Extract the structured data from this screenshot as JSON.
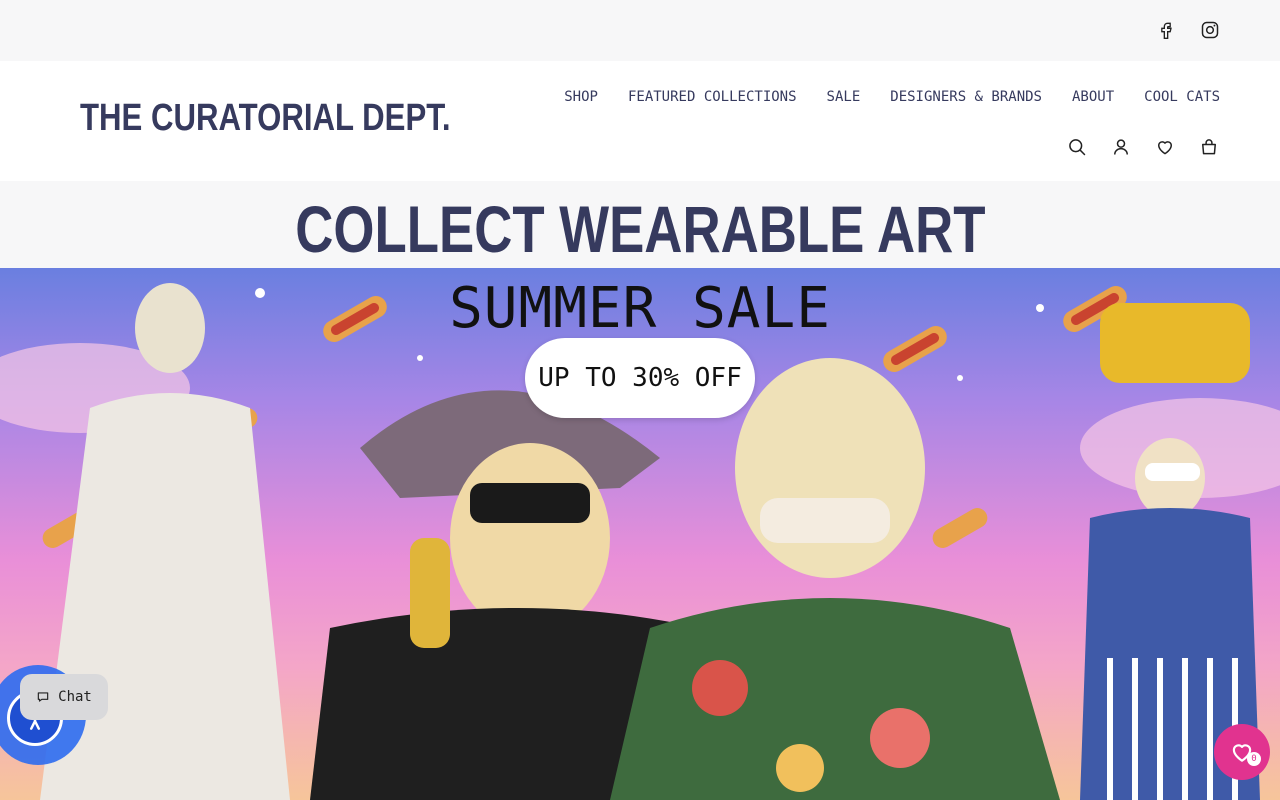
{
  "topbar": {
    "social": [
      {
        "name": "facebook-icon"
      },
      {
        "name": "instagram-icon"
      }
    ]
  },
  "header": {
    "logo": "THE CURATORIAL DEPT.",
    "nav": [
      "SHOP",
      "FEATURED COLLECTIONS",
      "SALE",
      "DESIGNERS & BRANDS",
      "ABOUT",
      "COOL CATS"
    ],
    "icons": [
      "search-icon",
      "account-icon",
      "wishlist-icon",
      "cart-icon"
    ]
  },
  "tagline": "COLLECT WEARABLE ART",
  "hero": {
    "title": "SUMMER SALE",
    "pill": "UP TO 30% OFF"
  },
  "widgets": {
    "chat_label": "Chat",
    "wishlist_count": "0"
  },
  "colors": {
    "brand": "#363a5e",
    "topbar_bg": "#f7f7f8",
    "wishlist_pink": "#e1338f",
    "accessibility_blue": "#2e6cf0"
  }
}
